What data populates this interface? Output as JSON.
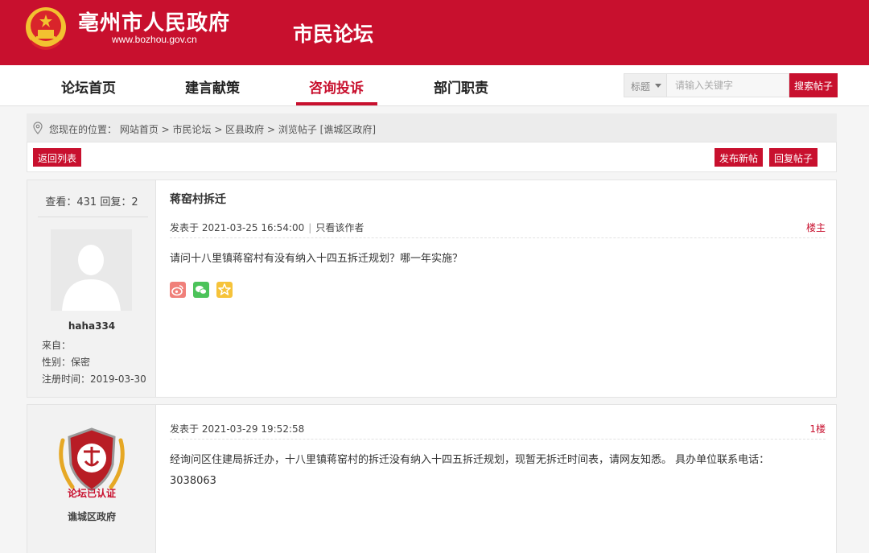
{
  "header": {
    "site_title": "亳州市人民政府",
    "site_url": "www.bozhou.gov.cn",
    "forum_name": "市民论坛"
  },
  "nav": {
    "items": [
      {
        "label": "论坛首页"
      },
      {
        "label": "建言献策"
      },
      {
        "label": "咨询投诉",
        "active": true
      },
      {
        "label": "部门职责"
      }
    ]
  },
  "search": {
    "select_value": "标题",
    "placeholder": "请输入关键字",
    "button_label": "搜索帖子"
  },
  "breadcrumb": {
    "text": "您现在的位置： 网站首页 > 市民论坛 > 区县政府 > 浏览帖子 [谯城区政府]"
  },
  "actions": {
    "back_label": "返回列表",
    "new_post_label": "发布新帖",
    "reply_label": "回复帖子"
  },
  "post1": {
    "stats": "查看：431 回复：2",
    "username": "haha334",
    "from": "来自：",
    "gender": "性别：保密",
    "register": "注册时间：2019-03-30",
    "title": "蒋窑村拆迁",
    "posted": "发表于 2021-03-25 16:54:00",
    "only_author": "只看该作者",
    "floor": "楼主",
    "body": "请问十八里镇蒋窑村有没有纳入十四五拆迁规划？哪一年实施？",
    "share_icons": [
      "weibo-icon",
      "wechat-icon",
      "favorite-icon"
    ]
  },
  "post2": {
    "badge_label": "论坛已认证",
    "dept": "谯城区政府",
    "posted": "发表于 2021-03-29 19:52:58",
    "floor": "1楼",
    "body_line1": "经询问区住建局拆迁办，十八里镇蒋窑村的拆迁没有纳入十四五拆迁规划，现暂无拆迁时间表，请网友知悉。 具办单位联系电话：",
    "body_line2": "3038063"
  },
  "colors": {
    "brand_red": "#c8102e",
    "page_bg": "#f5f5f5"
  }
}
